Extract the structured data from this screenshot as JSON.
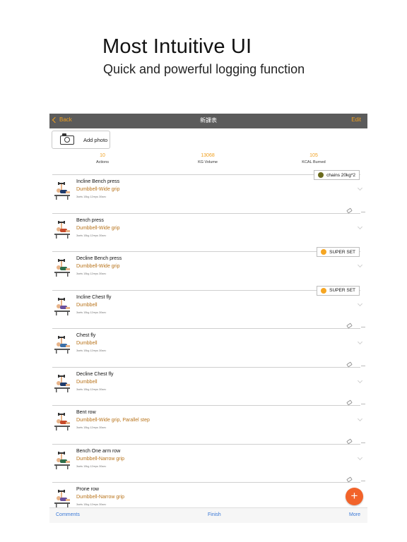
{
  "hero": {
    "title": "Most Intuitive UI",
    "subtitle": "Quick and powerful logging function"
  },
  "nav": {
    "back_label": "Back",
    "title": "新課表",
    "edit_label": "Edit",
    "bg_color": "#5b5b5b",
    "accent_color": "#f0a020"
  },
  "add_photo": {
    "label": "Add photo",
    "icon": "camera-icon"
  },
  "stats": [
    {
      "value": "10",
      "label": "Actions"
    },
    {
      "value": "13068",
      "label": "KG Volume"
    },
    {
      "value": "105",
      "label": "KCAL Burned"
    }
  ],
  "exercises": [
    {
      "name": "Incline Bench press",
      "equipment": "Dumbbell-Wide grip",
      "meta": "3sets 15kg 12reps 30sec",
      "badge": {
        "text": "chains 20kg*2",
        "dot_color": "#6b6b1e"
      }
    },
    {
      "name": "Bench press",
      "equipment": "Dumbbell-Wide grip",
      "meta": "3sets 15kg 12reps 30sec",
      "badge": null
    },
    {
      "name": "Decline Bench press",
      "equipment": "Dumbbell-Wide grip",
      "meta": "3sets 15kg 12reps 30sec",
      "badge": {
        "text": "SUPER SET",
        "dot_color": "#f5a623"
      }
    },
    {
      "name": "Incline Chest fly",
      "equipment": "Dumbbell",
      "meta": "3sets 15kg 12reps 30sec",
      "badge": {
        "text": "SUPER SET",
        "dot_color": "#f5a623"
      }
    },
    {
      "name": "Chest fly",
      "equipment": "Dumbbell",
      "meta": "3sets 15kg 12reps 30sec",
      "badge": null
    },
    {
      "name": "Decline Chest fly",
      "equipment": "Dumbbell",
      "meta": "3sets 15kg 12reps 30sec",
      "badge": null
    },
    {
      "name": "Bent row",
      "equipment": "Dumbbell-Wide grip, Parallel step",
      "meta": "3sets 15kg 12reps 30sec",
      "badge": null
    },
    {
      "name": "Bench One arm row",
      "equipment": "Dumbbell-Narrow grip",
      "meta": "3sets 15kg 12reps 30sec",
      "badge": null
    },
    {
      "name": "Prone row",
      "equipment": "Dumbbell-Narrow grip",
      "meta": "3sets 15kg 12reps 30sec",
      "badge": null
    }
  ],
  "fab": {
    "label": "+",
    "color": "#f2632a"
  },
  "bottom_bar": {
    "comments": "Comments",
    "finish": "Finish",
    "more": "More",
    "link_color": "#3a78d6"
  }
}
